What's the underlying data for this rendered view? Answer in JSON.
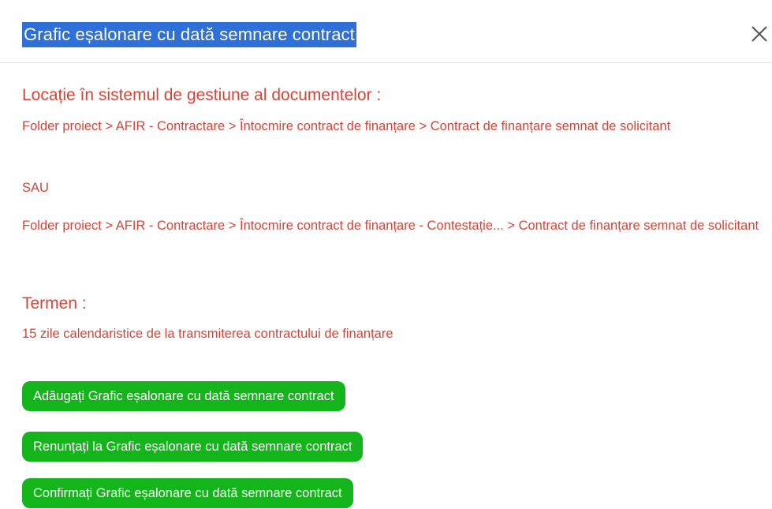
{
  "header": {
    "title": "Grafic eșalonare cu dată semnare contract",
    "close_icon": "close-icon"
  },
  "location": {
    "heading": "Locație în sistemul de gestiune al documentelor :",
    "path_1": "Folder proiect > AFIR - Contractare > Întocmire contract de finanțare > Contract de finanțare semnat de solicitant",
    "separator": "SAU",
    "path_2": "Folder proiect > AFIR - Contractare > Întocmire contract de finanțare - Contestație... > Contract de finanțare semnat de solicitant"
  },
  "term": {
    "heading": "Termen :",
    "text": "15 zile calendaristice de la transmiterea contractului de finanțare"
  },
  "actions": {
    "add_label": "Adăugați Grafic eșalonare cu dată semnare contract",
    "cancel_label": "Renunțați la Grafic eșalonare cu dată semnare contract",
    "confirm_label": "Confirmați Grafic eșalonare cu dată semnare contract"
  },
  "colors": {
    "title_highlight": "#2f6fd8",
    "text_red": "#d2463a",
    "button_green": "#13b51a"
  }
}
